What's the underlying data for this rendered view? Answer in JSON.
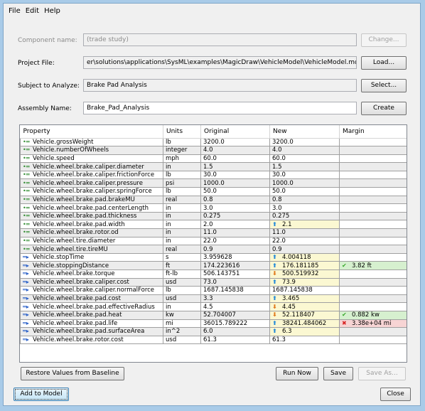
{
  "menu": [
    "File",
    "Edit",
    "Help"
  ],
  "form": {
    "component_label": "Component name:",
    "component_value": "(trade study)",
    "change_btn": "Change...",
    "project_label": "Project File:",
    "project_value": "er\\solutions\\applications\\SysML\\examples\\MagicDraw\\VehicleModel\\VehicleModel.mdzip",
    "load_btn": "Load...",
    "subject_label": "Subject to Analyze:",
    "subject_value": "Brake Pad Analysis",
    "select_btn": "Select...",
    "assembly_label": "Assembly Name:",
    "assembly_value": "Brake_Pad_Analysis",
    "create_btn": "Create"
  },
  "table": {
    "headers": [
      "Property",
      "Units",
      "Original",
      "New",
      "Margin"
    ],
    "rows": [
      {
        "dir": "in",
        "property": "Vehicle.grossWeight",
        "units": "lb",
        "original": "3200.0",
        "new": "3200.0",
        "trend": "",
        "margin": "",
        "status": ""
      },
      {
        "dir": "in",
        "property": "Vehicle.numberOfWheels",
        "units": "integer",
        "original": "4.0",
        "new": "4.0",
        "trend": "",
        "margin": "",
        "status": ""
      },
      {
        "dir": "in",
        "property": "Vehicle.speed",
        "units": "mph",
        "original": "60.0",
        "new": "60.0",
        "trend": "",
        "margin": "",
        "status": ""
      },
      {
        "dir": "in",
        "property": "Vehicle.wheel.brake.caliper.diameter",
        "units": "in",
        "original": "1.5",
        "new": "1.5",
        "trend": "",
        "margin": "",
        "status": ""
      },
      {
        "dir": "in",
        "property": "Vehicle.wheel.brake.caliper.frictionForce",
        "units": "lb",
        "original": "30.0",
        "new": "30.0",
        "trend": "",
        "margin": "",
        "status": ""
      },
      {
        "dir": "in",
        "property": "Vehicle.wheel.brake.caliper.pressure",
        "units": "psi",
        "original": "1000.0",
        "new": "1000.0",
        "trend": "",
        "margin": "",
        "status": ""
      },
      {
        "dir": "in",
        "property": "Vehicle.wheel.brake.caliper.springForce",
        "units": "lb",
        "original": "50.0",
        "new": "50.0",
        "trend": "",
        "margin": "",
        "status": ""
      },
      {
        "dir": "in",
        "property": "Vehicle.wheel.brake.pad.brakeMU",
        "units": "real",
        "original": "0.8",
        "new": "0.8",
        "trend": "",
        "margin": "",
        "status": ""
      },
      {
        "dir": "in",
        "property": "Vehicle.wheel.brake.pad.centerLength",
        "units": "in",
        "original": "3.0",
        "new": "3.0",
        "trend": "",
        "margin": "",
        "status": ""
      },
      {
        "dir": "in",
        "property": "Vehicle.wheel.brake.pad.thickness",
        "units": "in",
        "original": "0.275",
        "new": "0.275",
        "trend": "",
        "margin": "",
        "status": ""
      },
      {
        "dir": "in",
        "property": "Vehicle.wheel.brake.pad.width",
        "units": "in",
        "original": "2.0",
        "new": "2.1",
        "trend": "up",
        "margin": "",
        "status": ""
      },
      {
        "dir": "in",
        "property": "Vehicle.wheel.brake.rotor.od",
        "units": "in",
        "original": "11.0",
        "new": "11.0",
        "trend": "",
        "margin": "",
        "status": ""
      },
      {
        "dir": "in",
        "property": "Vehicle.wheel.tire.diameter",
        "units": "in",
        "original": "22.0",
        "new": "22.0",
        "trend": "",
        "margin": "",
        "status": ""
      },
      {
        "dir": "in",
        "property": "Vehicle.wheel.tire.tireMU",
        "units": "real",
        "original": "0.9",
        "new": "0.9",
        "trend": "",
        "margin": "",
        "status": ""
      },
      {
        "dir": "out",
        "property": "Vehicle.stopTime",
        "units": "s",
        "original": "3.959628",
        "new": "4.004118",
        "trend": "up",
        "margin": "",
        "status": ""
      },
      {
        "dir": "out",
        "property": "Vehicle.stoppingDistance",
        "units": "ft",
        "original": "174.223616",
        "new": "176.181185",
        "trend": "up",
        "margin": "3.82 ft",
        "status": "good"
      },
      {
        "dir": "out",
        "property": "Vehicle.wheel.brake.torque",
        "units": "ft-lb",
        "original": "506.143751",
        "new": "500.519932",
        "trend": "down",
        "margin": "",
        "status": ""
      },
      {
        "dir": "out",
        "property": "Vehicle.wheel.brake.caliper.cost",
        "units": "usd",
        "original": "73.0",
        "new": "73.9",
        "trend": "up",
        "margin": "",
        "status": ""
      },
      {
        "dir": "out",
        "property": "Vehicle.wheel.brake.caliper.normalForce",
        "units": "lb",
        "original": "1687.145838",
        "new": "1687.145838",
        "trend": "",
        "margin": "",
        "status": ""
      },
      {
        "dir": "out",
        "property": "Vehicle.wheel.brake.pad.cost",
        "units": "usd",
        "original": "3.3",
        "new": "3.465",
        "trend": "up",
        "margin": "",
        "status": ""
      },
      {
        "dir": "out",
        "property": "Vehicle.wheel.brake.pad.effectiveRadius",
        "units": "in",
        "original": "4.5",
        "new": "4.45",
        "trend": "down",
        "margin": "",
        "status": ""
      },
      {
        "dir": "out",
        "property": "Vehicle.wheel.brake.pad.heat",
        "units": "kw",
        "original": "52.704007",
        "new": "52.118407",
        "trend": "down",
        "margin": "0.882 kw",
        "status": "good"
      },
      {
        "dir": "out",
        "property": "Vehicle.wheel.brake.pad.life",
        "units": "mi",
        "original": "36015.789222",
        "new": "38241.484062",
        "trend": "up",
        "margin": "3.38e+04 mi",
        "status": "bad"
      },
      {
        "dir": "out",
        "property": "Vehicle.wheel.brake.pad.surfaceArea",
        "units": "in^2",
        "original": "6.0",
        "new": "6.3",
        "trend": "up",
        "margin": "",
        "status": ""
      },
      {
        "dir": "out",
        "property": "Vehicle.wheel.brake.rotor.cost",
        "units": "usd",
        "original": "61.3",
        "new": "61.3",
        "trend": "",
        "margin": "",
        "status": ""
      }
    ]
  },
  "buttons": {
    "restore": "Restore Values from Baseline",
    "run": "Run Now",
    "save": "Save",
    "save_as": "Save As...",
    "add": "Add to Model",
    "close": "Close"
  }
}
